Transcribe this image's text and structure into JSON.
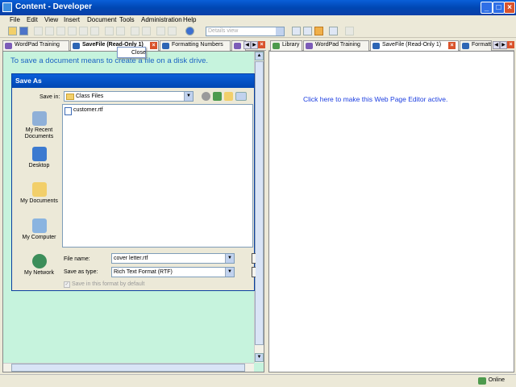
{
  "window": {
    "title": "Content - Developer"
  },
  "menu": [
    "File",
    "Edit",
    "View",
    "Insert",
    "Document",
    "Tools",
    "Administration",
    "Help"
  ],
  "toolbar": {
    "view_select": "Details view"
  },
  "left_tabs": [
    "WordPad Training",
    "SaveFile (Read-Only 1)",
    "Formatting Numbers"
  ],
  "context_menu": {
    "close": "Close"
  },
  "left_pane": {
    "intro": "To save a document means to create a file on a disk drive."
  },
  "save_dialog": {
    "title": "Save As",
    "save_in_label": "Save in:",
    "save_in_value": "Class Files",
    "places": [
      "My Recent Documents",
      "Desktop",
      "My Documents",
      "My Computer",
      "My Network"
    ],
    "files": [
      "customer.rtf"
    ],
    "file_name_label": "File name:",
    "file_name_value": "cover letter.rtf",
    "save_type_label": "Save as type:",
    "save_type_value": "Rich Text Format (RTF)",
    "default_checkbox": "Save in this format by default"
  },
  "right_tabs": [
    "Library",
    "WordPad Training",
    "SaveFile (Read-Only 1)",
    "Formatt"
  ],
  "right_pane": {
    "message": "Click here to make this Web Page Editor active."
  },
  "status": {
    "online": "Online"
  }
}
